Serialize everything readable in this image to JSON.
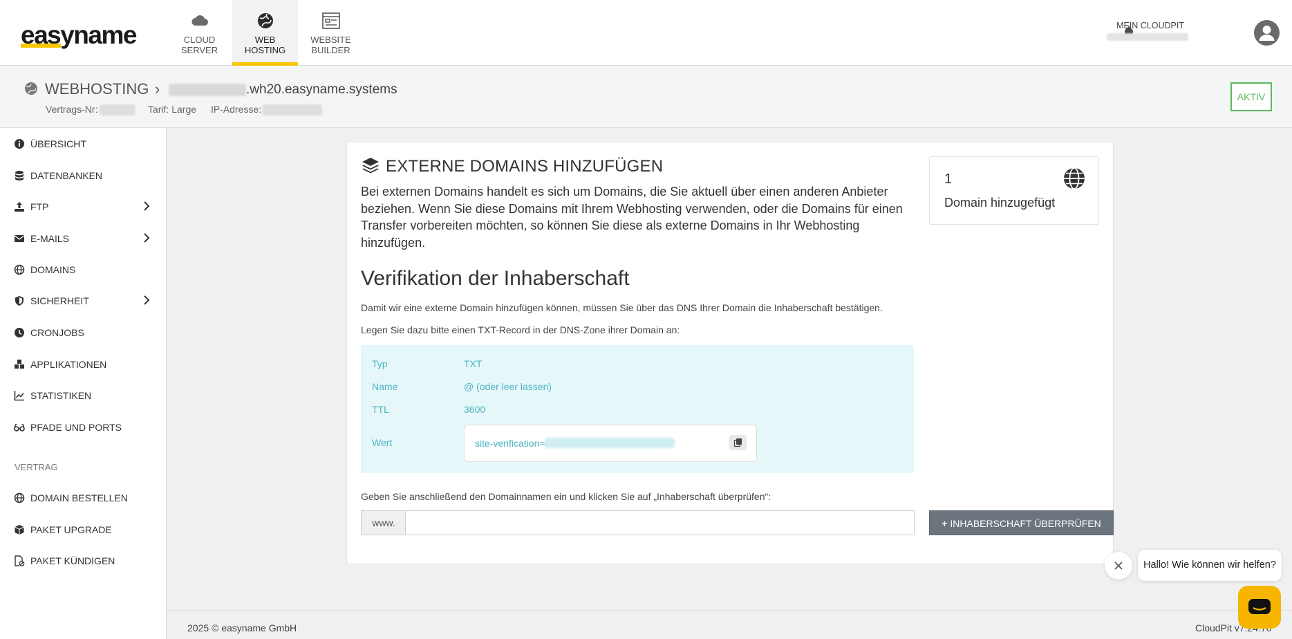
{
  "brand": {
    "logo": "easyname",
    "accent": "#f7c600"
  },
  "topnav": {
    "tabs": [
      {
        "line1": "CLOUD",
        "line2": "SERVER",
        "icon": "cloud-icon"
      },
      {
        "line1": "WEB",
        "line2": "HOSTING",
        "icon": "globe-icon",
        "active": true
      },
      {
        "line1": "WEBSITE",
        "line2": "BUILDER",
        "icon": "website-builder-icon"
      }
    ],
    "account_title": "MEIN CLOUDPIT"
  },
  "header": {
    "title": "WEBHOSTING",
    "chevron": "›",
    "hostname": ".wh20.easyname.systems",
    "contract_label": "Vertrags-Nr:",
    "tariff": "Tarif: Large",
    "ip_label": "IP-Adresse:",
    "status": "AKTIV",
    "status_color": "#5cb85c"
  },
  "sidebar": {
    "items": [
      {
        "label": "ÜBERSICHT",
        "icon": "info-icon"
      },
      {
        "label": "DATENBANKEN",
        "icon": "database-icon"
      },
      {
        "label": "FTP",
        "icon": "upload-icon",
        "expandable": true
      },
      {
        "label": "E-MAILS",
        "icon": "envelope-icon",
        "expandable": true
      },
      {
        "label": "DOMAINS",
        "icon": "globe-icon"
      },
      {
        "label": "SICHERHEIT",
        "icon": "shield-icon",
        "expandable": true
      },
      {
        "label": "CRONJOBS",
        "icon": "clock-icon"
      },
      {
        "label": "APPLIKATIONEN",
        "icon": "boxes-icon"
      },
      {
        "label": "STATISTIKEN",
        "icon": "chart-line-icon"
      },
      {
        "label": "PFADE UND PORTS",
        "icon": "glasses-icon"
      }
    ],
    "section": "VERTRAG",
    "contract_items": [
      {
        "label": "DOMAIN BESTELLEN",
        "icon": "globe-icon"
      },
      {
        "label": "PAKET UPGRADE",
        "icon": "box-icon"
      },
      {
        "label": "PAKET KÜNDIGEN",
        "icon": "file-cancel-icon"
      }
    ]
  },
  "main": {
    "title": "EXTERNE DOMAINS HINZUFÜGEN",
    "intro": "Bei externen Domains handelt es sich um Domains, die Sie aktuell über einen anderen Anbieter beziehen. Wenn Sie diese Domains mit Ihrem Webhosting verwenden, oder die Domains für einen Transfer vorbereiten möchten, so können Sie diese als externe Domains in Ihr Webhosting hinzufügen.",
    "verification_heading": "Verifikation der Inhaberschaft",
    "verification_text": "Damit wir eine externe Domain hinzufügen können, müssen Sie über das DNS Ihrer Domain die Inhaberschaft bestätigen.",
    "record_instruction": "Legen Sie dazu bitte einen TXT-Record in der DNS-Zone ihrer Domain an:",
    "dns": {
      "type_label": "Typ",
      "type_value": "TXT",
      "name_label": "Name",
      "name_value": "@ (oder leer lassen)",
      "ttl_label": "TTL",
      "ttl_value": "3600",
      "value_label": "Wert",
      "value_prefix": "site-verification=c"
    },
    "input_instruction": "Geben Sie anschließend den Domainnamen ein und klicken Sie auf „Inhaberschaft überprüfen“:",
    "input_prefix": "www.",
    "input_value": "",
    "input_placeholder": "",
    "verify_button": "INHABERSCHAFT ÜBERPRÜFEN",
    "stat": {
      "count": "1",
      "label": "Domain hinzugefügt"
    }
  },
  "footer": {
    "copyright": "2025 © easyname GmbH",
    "version": "CloudPit v7.24.70"
  },
  "chat": {
    "greeting": "Hallo! Wie können wir helfen?",
    "accent": "#f7b500"
  }
}
